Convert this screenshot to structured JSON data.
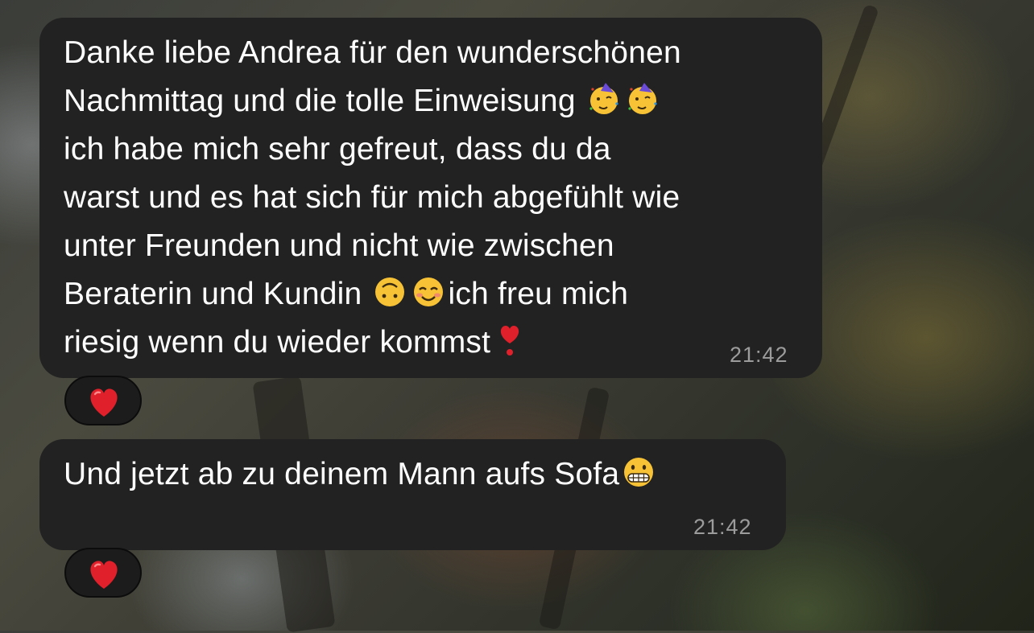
{
  "colors": {
    "bubble_background": "#222222",
    "text": "#ffffff",
    "timestamp": "#9c9c9c",
    "reaction_background": "#1c1c1c",
    "heart": "#e0202a"
  },
  "messages": [
    {
      "segments": [
        "Danke liebe Andrea für den wunderschönen",
        "Nachmittag und die tolle Einweisung",
        "ich habe mich sehr gefreut, dass du da",
        "warst und es hat sich für mich abgefühlt wie",
        "unter Freunden und nicht wie zwischen",
        "Beraterin und Kundin",
        "ich freu mich",
        "riesig wenn du wieder kommst"
      ],
      "emojis": [
        "partying-face-emoji",
        "partying-face-emoji",
        "upside-down-face-emoji",
        "smiling-face-emoji",
        "red-heart-exclamation-emoji"
      ],
      "time": "21:42",
      "reaction": "red-heart-icon"
    },
    {
      "segments": [
        "Und jetzt ab zu deinem Mann aufs Sofa"
      ],
      "emojis": [
        "grimacing-face-emoji"
      ],
      "time": "21:42",
      "reaction": "red-heart-icon"
    }
  ]
}
